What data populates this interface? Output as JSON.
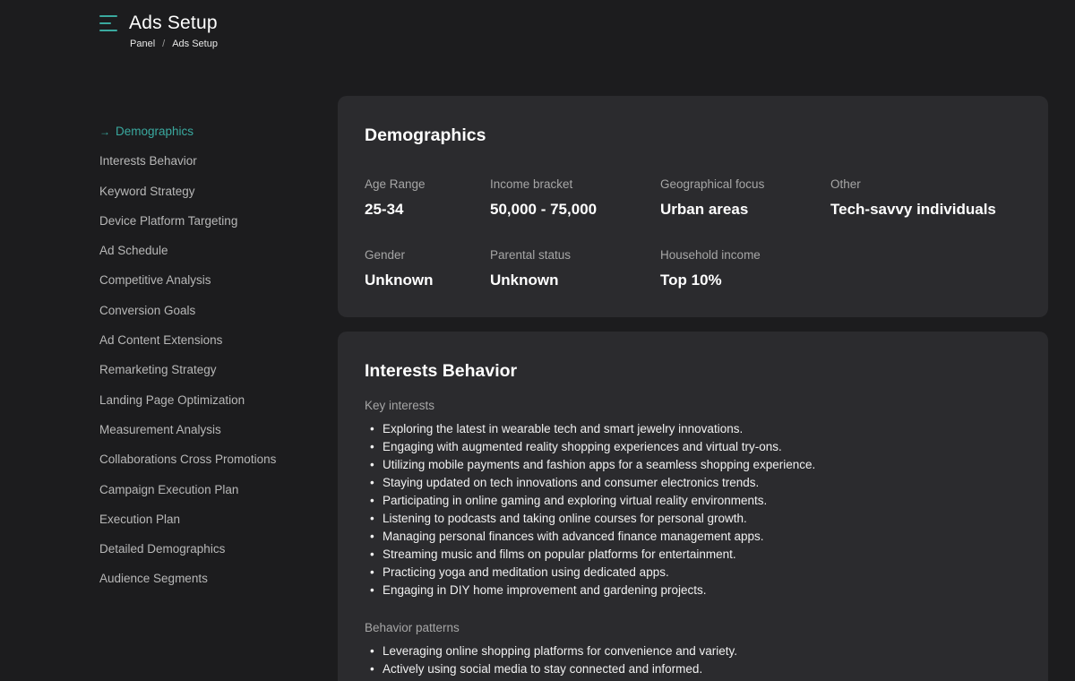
{
  "header": {
    "title": "Ads Setup",
    "breadcrumb": {
      "root": "Panel",
      "separator": "/",
      "current": "Ads Setup"
    }
  },
  "sidebar": {
    "active_arrow": "→",
    "items": [
      {
        "label": "Demographics",
        "active": true
      },
      {
        "label": "Interests Behavior"
      },
      {
        "label": "Keyword Strategy"
      },
      {
        "label": "Device Platform Targeting"
      },
      {
        "label": "Ad Schedule"
      },
      {
        "label": "Competitive Analysis"
      },
      {
        "label": "Conversion Goals"
      },
      {
        "label": "Ad Content Extensions"
      },
      {
        "label": "Remarketing Strategy"
      },
      {
        "label": "Landing Page Optimization"
      },
      {
        "label": "Measurement Analysis"
      },
      {
        "label": "Collaborations Cross Promotions"
      },
      {
        "label": "Campaign Execution Plan"
      },
      {
        "label": "Execution Plan"
      },
      {
        "label": "Detailed Demographics"
      },
      {
        "label": "Audience Segments"
      }
    ]
  },
  "demographics": {
    "title": "Demographics",
    "age_range": {
      "label": "Age Range",
      "value": "25-34"
    },
    "income_bracket": {
      "label": "Income bracket",
      "value": "50,000 - 75,000"
    },
    "geo_focus": {
      "label": "Geographical focus",
      "value": "Urban areas"
    },
    "other": {
      "label": "Other",
      "value": "Tech-savvy individuals"
    },
    "gender": {
      "label": "Gender",
      "value": "Unknown"
    },
    "parental_status": {
      "label": "Parental status",
      "value": "Unknown"
    },
    "household_income": {
      "label": "Household income",
      "value": "Top 10%"
    }
  },
  "interests": {
    "title": "Interests Behavior",
    "key_interests_label": "Key interests",
    "key_interests": [
      "Exploring the latest in wearable tech and smart jewelry innovations.",
      "Engaging with augmented reality shopping experiences and virtual try-ons.",
      "Utilizing mobile payments and fashion apps for a seamless shopping experience.",
      "Staying updated on tech innovations and consumer electronics trends.",
      "Participating in online gaming and exploring virtual reality environments.",
      "Listening to podcasts and taking online courses for personal growth.",
      "Managing personal finances with advanced finance management apps.",
      "Streaming music and films on popular platforms for entertainment.",
      "Practicing yoga and meditation using dedicated apps.",
      "Engaging in DIY home improvement and gardening projects."
    ],
    "behavior_label": "Behavior patterns",
    "behavior_patterns": [
      "Leveraging online shopping platforms for convenience and variety.",
      "Actively using social media to stay connected and informed."
    ]
  },
  "colors": {
    "background": "#1c1c1e",
    "card": "#2b2b2e",
    "accent": "#3aa99f"
  },
  "icons": {
    "menu": "hamburger-menu-icon",
    "active_marker": "arrow-right-icon"
  }
}
